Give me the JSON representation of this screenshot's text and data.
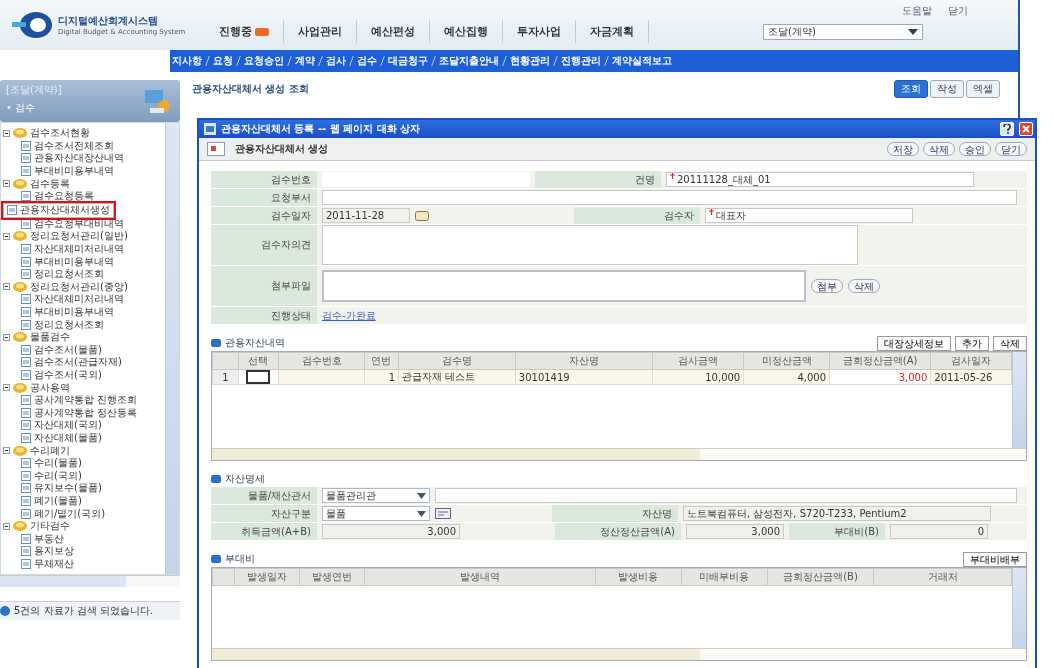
{
  "app": {
    "logo_title": "디지털예산회계시스템",
    "logo_subtitle": "Digital Budget & Accounting System",
    "top_links": [
      "도움말",
      "닫기"
    ],
    "menu": [
      {
        "label": "진행중",
        "badge": true
      },
      {
        "label": "사업관리",
        "badge": false
      },
      {
        "label": "예산편성",
        "badge": false
      },
      {
        "label": "예산집행",
        "badge": false
      },
      {
        "label": "투자사업",
        "badge": false
      },
      {
        "label": "자금계획",
        "badge": false
      }
    ],
    "org_select": "조달(계약)",
    "submenu": [
      "지사항",
      "요청",
      "요청승인",
      "계약",
      "검사",
      "검수",
      "대금청구",
      "조달지출안내",
      "현황관리",
      "진행관리",
      "계약실적보고"
    ]
  },
  "sidebar": {
    "title": "[조달(계약)]",
    "section": "• 검수",
    "tree": [
      {
        "label": "검수조서현황",
        "selected": false,
        "children": [
          {
            "label": "검수조서전체조회",
            "selected": false
          },
          {
            "label": "관용자산대장산내역",
            "selected": false
          },
          {
            "label": "부대비미용부내역",
            "selected": false
          }
        ]
      },
      {
        "label": "검수등록",
        "selected": false,
        "children": [
          {
            "label": "검수요청등록",
            "selected": false
          },
          {
            "label": "관용자산대체서생성",
            "selected": true
          },
          {
            "label": "검수요청부대비내역",
            "selected": false
          }
        ]
      },
      {
        "label": "정리요청서관리(일반)",
        "selected": false,
        "children": [
          {
            "label": "자산대체미처리내역",
            "selected": false
          },
          {
            "label": "부대비미용부내역",
            "selected": false
          },
          {
            "label": "정리요청서조회",
            "selected": false
          }
        ]
      },
      {
        "label": "정리요청서관리(중앙)",
        "selected": false,
        "children": [
          {
            "label": "자산대체미처리내역",
            "selected": false
          },
          {
            "label": "부대비미용부내역",
            "selected": false
          },
          {
            "label": "정리요청서조회",
            "selected": false
          }
        ]
      },
      {
        "label": "물품검수",
        "selected": false,
        "children": [
          {
            "label": "검수조서(물품)",
            "selected": false
          },
          {
            "label": "검수조서(관급자재)",
            "selected": false
          },
          {
            "label": "검수조서(국외)",
            "selected": false
          }
        ]
      },
      {
        "label": "공사용역",
        "selected": false,
        "children": [
          {
            "label": "공사계약통합 진행조회",
            "selected": false
          },
          {
            "label": "공사계약통합 정산등록",
            "selected": false
          },
          {
            "label": "자산대체(국외)",
            "selected": false
          },
          {
            "label": "자산대체(물품)",
            "selected": false
          }
        ]
      },
      {
        "label": "수리폐기",
        "selected": false,
        "children": [
          {
            "label": "수리(물품)",
            "selected": false
          },
          {
            "label": "수리(국외)",
            "selected": false
          },
          {
            "label": "유지보수(물품)",
            "selected": false
          },
          {
            "label": "폐기(물품)",
            "selected": false
          },
          {
            "label": "폐기/멸기(국외)",
            "selected": false
          }
        ]
      },
      {
        "label": "기타검수",
        "selected": false,
        "children": [
          {
            "label": "부동산",
            "selected": false
          },
          {
            "label": "용지보상",
            "selected": false
          },
          {
            "label": "무체재산",
            "selected": false
          }
        ]
      }
    ],
    "status": "5건의 자료가 검색 되었습니다."
  },
  "page": {
    "title": "관용자산대체서 생성 조회",
    "buttons": [
      {
        "label": "조회",
        "primary": true
      },
      {
        "label": "작성",
        "primary": false
      },
      {
        "label": "엑셀",
        "primary": false
      }
    ]
  },
  "dialog": {
    "title": "관용자산대체서 등록 -- 웹 페이지 대화 상자",
    "heading": "관용자산대체서 생성",
    "buttons": [
      "저장",
      "삭제",
      "승인",
      "닫기"
    ],
    "form": {
      "inspection_no": {
        "label": "검수번호"
      },
      "subject": {
        "label": "건명",
        "value": "20111128_대체_01"
      },
      "request_dept": {
        "label": "요청부서"
      },
      "inspection_date": {
        "label": "검수일자",
        "value": "2011-11-28"
      },
      "inspector": {
        "label": "검수자",
        "value": "대표자"
      },
      "opinion": {
        "label": "검수자의견"
      },
      "attachment": {
        "label": "첨부파일",
        "buttons": [
          "첨부",
          "삭제"
        ]
      },
      "progress": {
        "label": "진행상태",
        "value": "검수-가완료"
      }
    },
    "assets": {
      "title": "관용자산내역",
      "buttons": [
        "대장상세정보",
        "추가",
        "삭제"
      ],
      "columns": [
        {
          "label": "선택",
          "kind": "check"
        },
        {
          "label": "검수번호",
          "kind": "text"
        },
        {
          "label": "연번",
          "kind": "number"
        },
        {
          "label": "검수명",
          "kind": "text"
        },
        {
          "label": "자산명",
          "kind": "text"
        },
        {
          "label": "검사금액",
          "kind": "number"
        },
        {
          "label": "미정산금액",
          "kind": "number"
        },
        {
          "label": "금회정산금액(A)",
          "kind": "entry"
        },
        {
          "label": "검사일자",
          "kind": "text"
        }
      ],
      "rows": [
        {
          "row_number": "1",
          "checked": false,
          "cells": [
            "",
            "",
            "1",
            "관급자재 테스트",
            "30101419",
            "10,000",
            "4,000",
            "3,000",
            "2011-05-26"
          ]
        }
      ]
    },
    "detail": {
      "title": "자산명세",
      "office": {
        "label": "물품/재산관서",
        "value": "물품관리관"
      },
      "category": {
        "label": "자산구분",
        "value": "물품"
      },
      "asset_name": {
        "label": "자산명",
        "value": "노트북컴퓨터, 삼성전자, S720-T233, Pentium2"
      },
      "acquisition": {
        "label": "취득금액(A+B)",
        "value": "3,000"
      },
      "settled": {
        "label": "정산정산금액(A)",
        "value": "3,000"
      },
      "incidental": {
        "label": "부대비(B)",
        "value": "0"
      }
    },
    "costs": {
      "title": "부대비",
      "button": "부대비배부",
      "columns": [
        "발생일자",
        "발생연번",
        "발생내역",
        "발생비용",
        "미배부비용",
        "금회정산금액(B)",
        "거래처"
      ]
    }
  }
}
